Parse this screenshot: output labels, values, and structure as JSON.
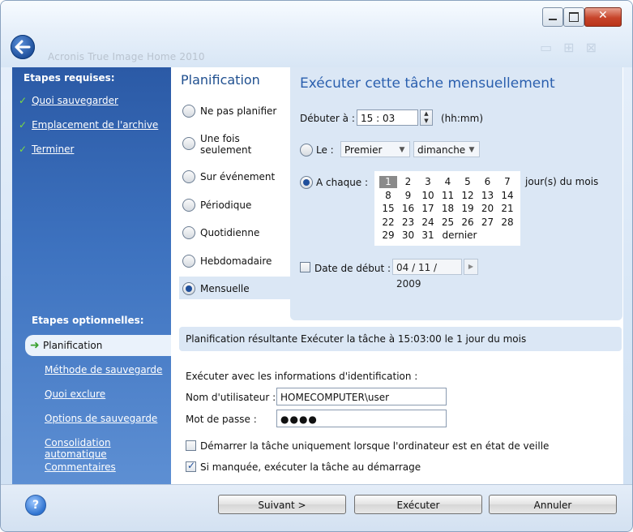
{
  "window": {
    "title": "Acronis True Image Home 2010"
  },
  "sidebar": {
    "required_header": "Etapes requises:",
    "required_items": [
      {
        "label": "Quoi sauvegarder"
      },
      {
        "label": "Emplacement de l'archive"
      },
      {
        "label": "Terminer"
      }
    ],
    "optional_header": "Etapes optionnelles:",
    "active_item": "Planification",
    "optional_items": [
      {
        "label": "Méthode de sauvegarde"
      },
      {
        "label": "Quoi exclure"
      },
      {
        "label": "Options de sauvegarde"
      },
      {
        "label": "Consolidation automatique"
      },
      {
        "label": "Commentaires"
      }
    ]
  },
  "planning": {
    "title": "Planification",
    "options": [
      {
        "label": "Ne pas planifier",
        "selected": false
      },
      {
        "label": "Une fois\nseulement",
        "selected": false
      },
      {
        "label": "Sur événement",
        "selected": false
      },
      {
        "label": "Périodique",
        "selected": false
      },
      {
        "label": "Quotidienne",
        "selected": false
      },
      {
        "label": "Hebdomadaire",
        "selected": false
      },
      {
        "label": "Mensuelle",
        "selected": true
      }
    ]
  },
  "monthly": {
    "title": "Exécuter cette tâche mensuellement",
    "start_label": "Débuter à :",
    "start_time": "15 : 03",
    "time_format": "(hh:mm)",
    "le_label": "Le :",
    "le_ordinal": "Premier",
    "le_day": "dimanche",
    "each_label": "A chaque :",
    "days_suffix": "jour(s) du mois",
    "calendar_days": [
      "1",
      "2",
      "3",
      "4",
      "5",
      "6",
      "7",
      "8",
      "9",
      "10",
      "11",
      "12",
      "13",
      "14",
      "15",
      "16",
      "17",
      "18",
      "19",
      "20",
      "21",
      "22",
      "23",
      "24",
      "25",
      "26",
      "27",
      "28",
      "29",
      "30",
      "31"
    ],
    "calendar_last": "dernier",
    "selected_day": "1",
    "start_date_label": "Date de début :",
    "start_date_value": "04 / 11 / 2009"
  },
  "summary": {
    "label": "Planification résultante :",
    "text": "Exécuter la tâche à 15:03:00 le 1 jour du mois"
  },
  "credentials": {
    "header": "Exécuter avec les informations d'identification :",
    "user_label": "Nom d'utilisateur :",
    "user_value": "HOMECOMPUTER\\user",
    "password_label": "Mot de passe :",
    "password_value": "●●●●"
  },
  "checks": {
    "standby_label": "Démarrer la tâche uniquement lorsque l'ordinateur est en état de veille",
    "standby_checked": false,
    "missed_label": "Si manquée, exécuter la tâche au démarrage",
    "missed_checked": true
  },
  "footer": {
    "help": "?",
    "next": "Suivant >",
    "execute": "Exécuter",
    "cancel": "Annuler"
  }
}
